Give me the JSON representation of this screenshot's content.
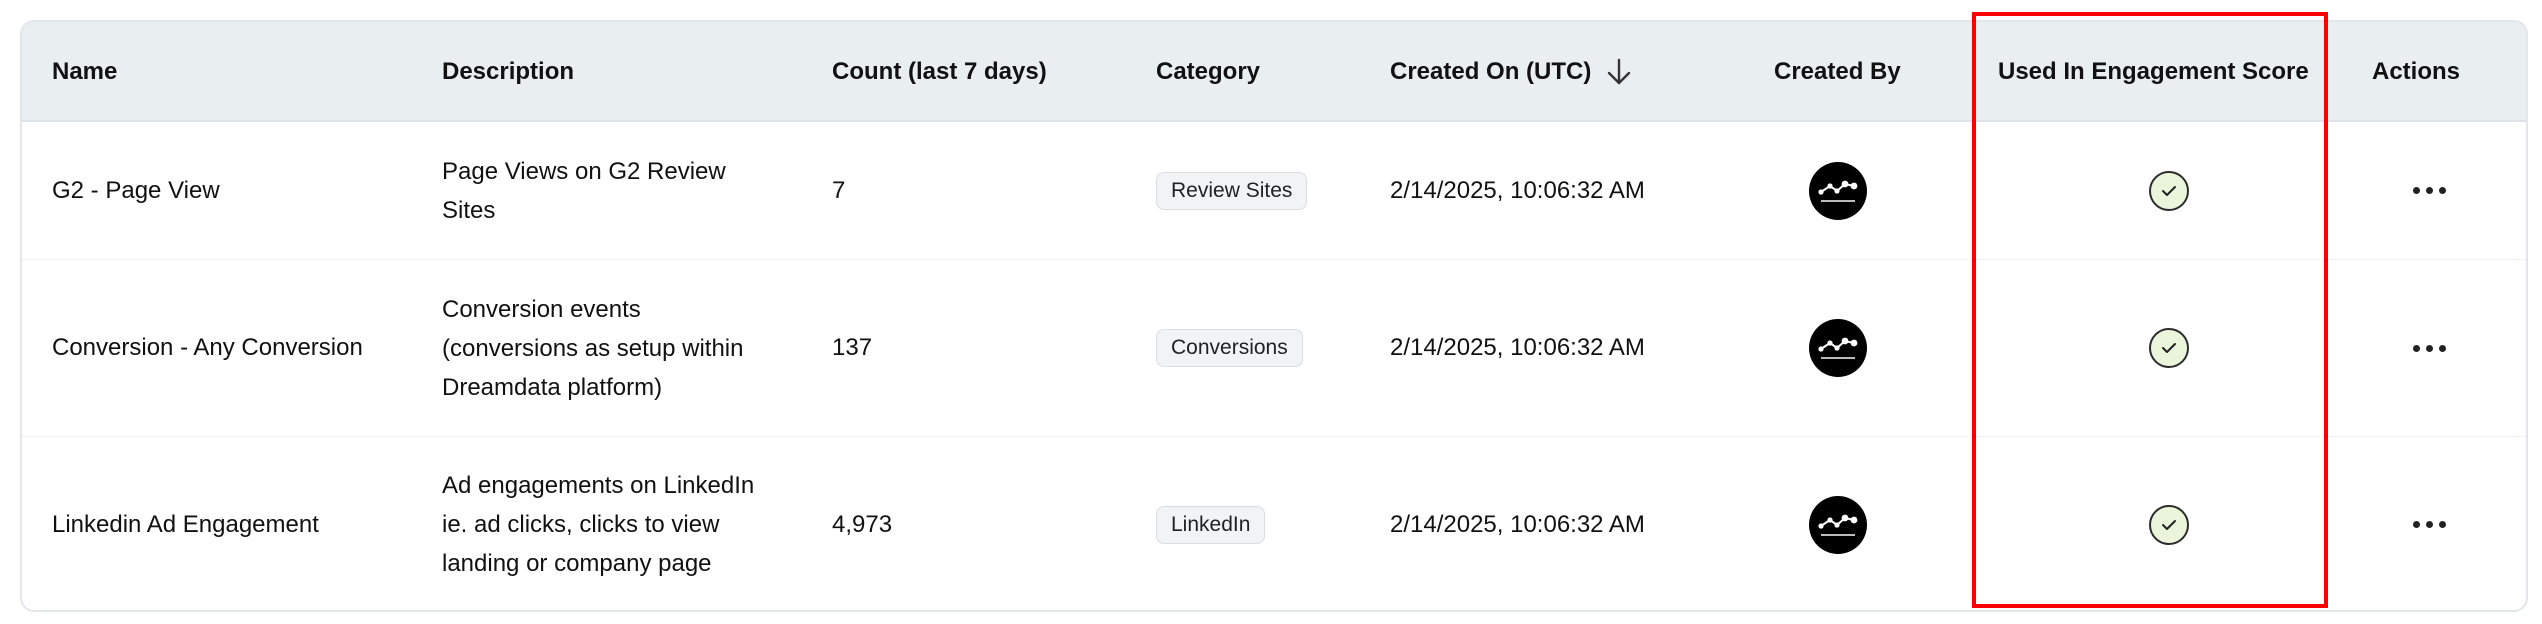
{
  "columns": {
    "name": "Name",
    "description": "Description",
    "count": "Count (last 7 days)",
    "category": "Category",
    "created_on": "Created On (UTC)",
    "created_by": "Created By",
    "engagement": "Used In Engagement Score",
    "actions": "Actions"
  },
  "sort": {
    "column": "created_on",
    "direction": "descending",
    "icon": "arrow-down-icon"
  },
  "rows": [
    {
      "name": "G2 - Page View",
      "description": "Page Views on G2 Review\nSites",
      "count": "7",
      "category": "Review Sites",
      "created_on": "2/14/2025, 10:06:32 AM",
      "created_by_avatar": "dreamdata-logo",
      "used_in_engagement": true,
      "actions_icon": "more-horizontal-icon"
    },
    {
      "name": "Conversion - Any Conversion",
      "description": "Conversion events\n(conversions as setup within\nDreamdata platform)",
      "count": "137",
      "category": "Conversions",
      "created_on": "2/14/2025, 10:06:32 AM",
      "created_by_avatar": "dreamdata-logo",
      "used_in_engagement": true,
      "actions_icon": "more-horizontal-icon"
    },
    {
      "name": "Linkedin Ad Engagement",
      "description": "Ad engagements on LinkedIn\nie. ad clicks, clicks to view\nlanding or company page",
      "count": "4,973",
      "category": "LinkedIn",
      "created_on": "2/14/2025, 10:06:32 AM",
      "created_by_avatar": "dreamdata-logo",
      "used_in_engagement": true,
      "actions_icon": "more-horizontal-icon"
    }
  ],
  "highlight": {
    "target": "engagement-column",
    "color": "#ff0000"
  },
  "colors": {
    "header_bg": "#e9eef1",
    "check_bg": "#eaf5dc",
    "avatar_bg": "#000000"
  }
}
